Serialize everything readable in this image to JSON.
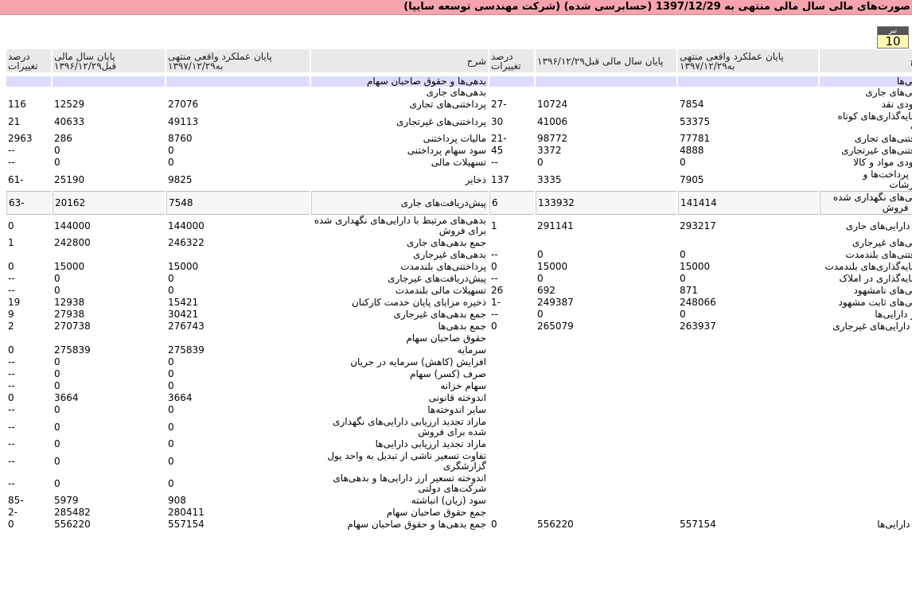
{
  "title": "صورت‌های مالی سال مالی منتهی به 1397/12/29 (حسابرسی شده) (شرکت مهندسی توسعه سایپا)",
  "date_badge": {
    "month": "تیر",
    "day": "10"
  },
  "headers": {
    "desc": "شرح",
    "cur": "پایان عملکرد واقعی منتهی به۱۳۹۷/۱۲/۲۹",
    "prev": "پایان سال مالی قبل۱۳۹۶/۱۲/۲۹",
    "pct": "درصد تغییرات"
  },
  "rows": [
    {
      "t": "sec",
      "a": [
        "دارایی‌ها",
        "",
        "",
        "",
        "بدهی‌ها و حقوق صاحبان سهام",
        "",
        "",
        ""
      ]
    },
    {
      "t": "r",
      "a": [
        "دارایی‌های جاری",
        "",
        "",
        "",
        "بدهی‌های جاری",
        "",
        "",
        ""
      ]
    },
    {
      "t": "r",
      "a": [
        "موجودی نقد",
        "7854",
        "10724",
        "-27",
        "پرداختنی‌های تجاری",
        "27076",
        "12529",
        "116"
      ]
    },
    {
      "t": "r2",
      "a": [
        "سرمایه‌گذاری‌های کوتاه مدت",
        "53375",
        "41006",
        "30",
        "پرداختنی‌های غیرتجاری",
        "49113",
        "40633",
        "21"
      ]
    },
    {
      "t": "r",
      "a": [
        "دریافتنی‌های تجاری",
        "77781",
        "98772",
        "-21",
        "مالیات پرداختنی",
        "8760",
        "286",
        "2963"
      ]
    },
    {
      "t": "r",
      "a": [
        "دریافتنی‌های غیرتجاری",
        "4888",
        "3372",
        "45",
        "سود سهام پرداختنی",
        "0",
        "0",
        "--"
      ]
    },
    {
      "t": "r",
      "a": [
        "موجودی مواد و کالا",
        "0",
        "0",
        "--",
        "تسهیلات مالی",
        "0",
        "0",
        "--"
      ]
    },
    {
      "t": "r2",
      "a": [
        "پیش پرداخت‌ها و سفارشات",
        "7905",
        "3335",
        "137",
        "ذخایر",
        "9825",
        "25190",
        "-61"
      ]
    },
    {
      "t": "box",
      "a": [
        "دارایی‌های نگهداری شده برای فروش",
        "141414",
        "133932",
        "6",
        "پیش‌دریافت‌های جاری",
        "7548",
        "20162",
        "-63"
      ]
    },
    {
      "t": "r2",
      "a": [
        "جمع دارایی‌های جاری",
        "293217",
        "291141",
        "1",
        "بدهی‌های مرتبط با دارایی‌های نگهداری شده برای فروش",
        "144000",
        "144000",
        "0"
      ]
    },
    {
      "t": "r",
      "a": [
        "دارایی‌های غیرجاری",
        "",
        "",
        "",
        "جمع بدهی‌های جاری",
        "246322",
        "242800",
        "1"
      ]
    },
    {
      "t": "r",
      "a": [
        "دریافتنی‌های بلندمدت",
        "0",
        "0",
        "--",
        "بدهی‌های غیرجاری",
        "",
        "",
        ""
      ]
    },
    {
      "t": "r",
      "a": [
        "سرمایه‌گذاری‌های بلندمدت",
        "15000",
        "15000",
        "0",
        "پرداختنی‌های بلندمدت",
        "15000",
        "15000",
        "0"
      ]
    },
    {
      "t": "r",
      "a": [
        "سرمایه‌گذاری در املاک",
        "0",
        "0",
        "--",
        "پیش‌دریافت‌های غیرجاری",
        "0",
        "0",
        "--"
      ]
    },
    {
      "t": "r",
      "a": [
        "دارایی‌های نامشهود",
        "871",
        "692",
        "26",
        "تسهیلات مالی بلندمدت",
        "0",
        "0",
        "--"
      ]
    },
    {
      "t": "r",
      "a": [
        "دارایی‌های ثابت مشهود",
        "248066",
        "249387",
        "-1",
        "ذخیره مزایای پایان خدمت کارکنان",
        "15421",
        "12938",
        "19"
      ]
    },
    {
      "t": "r",
      "a": [
        "سایر دارایی‌ها",
        "0",
        "0",
        "--",
        "جمع بدهی‌های غیرجاری",
        "30421",
        "27938",
        "9"
      ]
    },
    {
      "t": "r",
      "a": [
        "جمع دارایی‌های غیرجاری",
        "263937",
        "265079",
        "0",
        "جمع بدهی‌ها",
        "276743",
        "270738",
        "2"
      ]
    },
    {
      "t": "r",
      "a": [
        "",
        "",
        "",
        "",
        "حقوق صاحبان سهام",
        "",
        "",
        ""
      ]
    },
    {
      "t": "r",
      "a": [
        "",
        "",
        "",
        "",
        "سرمایه",
        "275839",
        "275839",
        "0"
      ]
    },
    {
      "t": "r",
      "a": [
        "",
        "",
        "",
        "",
        "افزایش (کاهش) سرمایه در جریان",
        "0",
        "0",
        "--"
      ]
    },
    {
      "t": "r",
      "a": [
        "",
        "",
        "",
        "",
        "صرف (کسر) سهام",
        "0",
        "0",
        "--"
      ]
    },
    {
      "t": "r",
      "a": [
        "",
        "",
        "",
        "",
        "سهام خزانه",
        "0",
        "0",
        "--"
      ]
    },
    {
      "t": "r",
      "a": [
        "",
        "",
        "",
        "",
        "اندوخته قانونی",
        "3664",
        "3664",
        "0"
      ]
    },
    {
      "t": "r",
      "a": [
        "",
        "",
        "",
        "",
        "سایر اندوخته‌ها",
        "0",
        "0",
        "--"
      ]
    },
    {
      "t": "r2",
      "a": [
        "",
        "",
        "",
        "",
        "مازاد تجدید ارزیابی دارایی‌های نگهداری شده برای فروش",
        "0",
        "0",
        "--"
      ]
    },
    {
      "t": "r",
      "a": [
        "",
        "",
        "",
        "",
        "مازاد تجدید ارزیابی دارایی‌ها",
        "0",
        "0",
        "--"
      ]
    },
    {
      "t": "r2",
      "a": [
        "",
        "",
        "",
        "",
        "تفاوت تسعیر ناشی از تبدیل به واحد پول گزارشگری",
        "0",
        "0",
        "--"
      ]
    },
    {
      "t": "r2",
      "a": [
        "",
        "",
        "",
        "",
        "اندوخته تسعیر ارز دارایی‌ها و بدهی‌های شرکت‌های دولتی",
        "0",
        "0",
        "--"
      ]
    },
    {
      "t": "r",
      "a": [
        "",
        "",
        "",
        "",
        "سود (زیان) انباشته",
        "908",
        "5979",
        "-85"
      ]
    },
    {
      "t": "r",
      "a": [
        "",
        "",
        "",
        "",
        "جمع حقوق صاحبان سهام",
        "280411",
        "285482",
        "-2"
      ]
    },
    {
      "t": "r",
      "a": [
        "جمع دارایی‌ها",
        "557154",
        "556220",
        "0",
        "جمع بدهی‌ها و حقوق صاحبان سهام",
        "557154",
        "556220",
        "0"
      ]
    }
  ]
}
